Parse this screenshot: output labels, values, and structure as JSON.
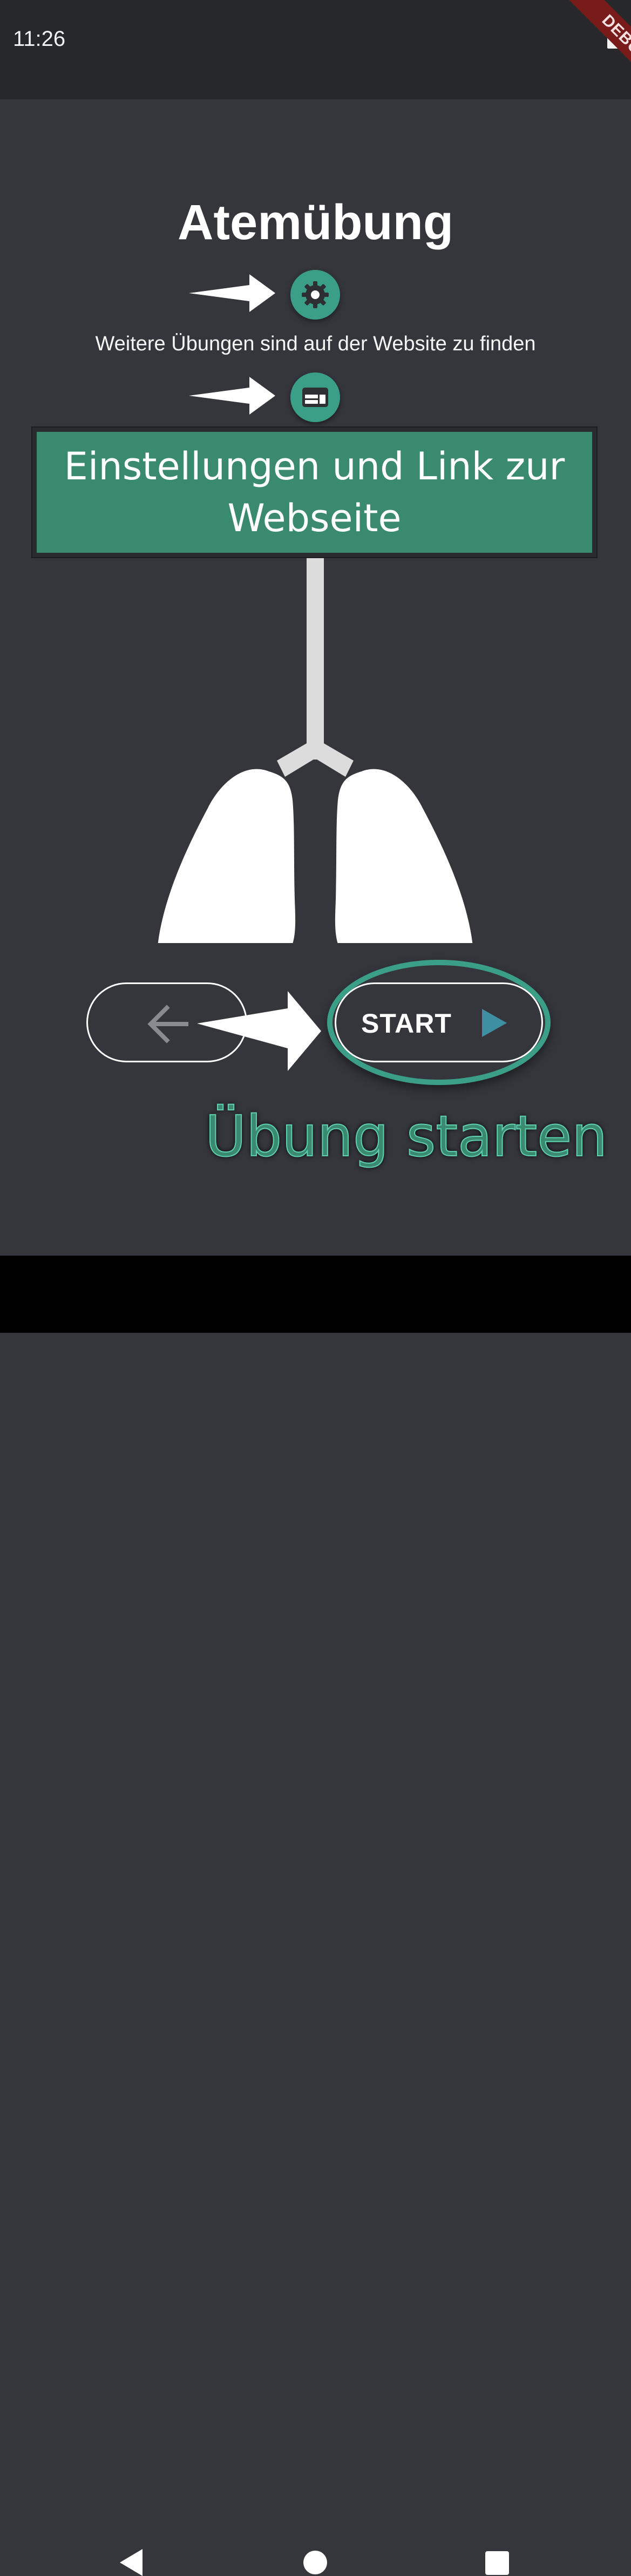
{
  "status_bar": {
    "time": "11:26",
    "battery_icon": "battery-icon"
  },
  "debug_banner": {
    "label": "DEBUG"
  },
  "header": {
    "title": "Atemübung"
  },
  "settings": {
    "icon": "gear-icon",
    "accent": "#3a9f86"
  },
  "website_hint": {
    "text": "Weitere Übungen sind auf der Website zu finden"
  },
  "website_link": {
    "icon": "browser-window-icon"
  },
  "overlay": {
    "text": "Einstellungen und Link zur Webseite",
    "color": "#3a8a70"
  },
  "illustration": {
    "name": "lungs-illustration"
  },
  "controls": {
    "back_icon": "arrow-left-icon",
    "start_label": "START",
    "start_icon": "play-icon",
    "start_icon_color": "#3f8fa3"
  },
  "annotation": {
    "caption": "Übung starten"
  },
  "nav_bar": {
    "back": "back-icon",
    "home": "home-icon",
    "recents": "recents-icon"
  }
}
